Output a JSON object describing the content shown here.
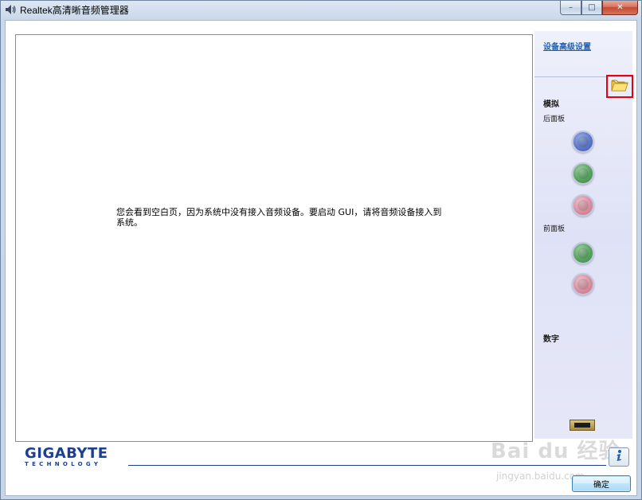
{
  "window": {
    "title": "Realtek高清晰音频管理器",
    "controls": {
      "minimize": "–",
      "maximize": "□",
      "close": "✕"
    }
  },
  "main": {
    "empty_message": "您会看到空白页，因为系统中没有接入音频设备。要启动 GUI，请将音频设备接入到系统。"
  },
  "sidebar": {
    "advanced_link": "设备高级设置",
    "folder_icon": "folder-icon",
    "analog_label": "模拟",
    "rear_panel_label": "后面板",
    "front_panel_label": "前面板",
    "digital_label": "数字",
    "rear_jacks": [
      {
        "color_name": "blue",
        "color": "#5c77c9"
      },
      {
        "color_name": "green",
        "color": "#56a25f"
      },
      {
        "color_name": "pink",
        "color": "#d98ea0"
      }
    ],
    "front_jacks": [
      {
        "color_name": "green",
        "color": "#56a25f"
      },
      {
        "color_name": "pink",
        "color": "#d98ea0"
      }
    ]
  },
  "footer": {
    "logo_main": "GIGABYTE",
    "logo_sub": "TECHNOLOGY",
    "info_icon": "info-icon",
    "ok_label": "确定"
  },
  "watermark": {
    "main": "Bai du 经验",
    "sub": "jingyan.baidu.com"
  },
  "colors": {
    "brand": "#1c3f8f",
    "link": "#1f5fb0",
    "highlight_box": "#e60012"
  }
}
